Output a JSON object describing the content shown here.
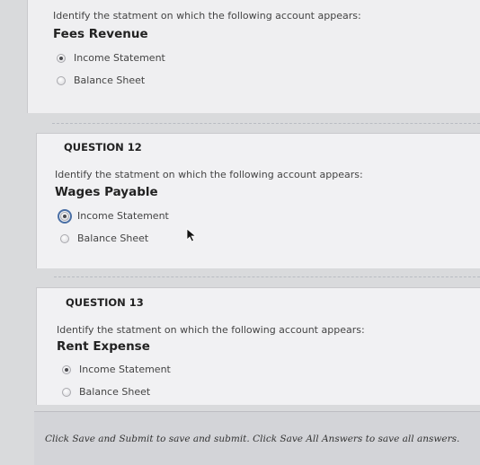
{
  "questions": [
    {
      "number_label": "",
      "prompt": "Identify the statment on which the following account appears:",
      "term": "Fees Revenue",
      "options": [
        {
          "label": "Income Statement",
          "selected": true
        },
        {
          "label": "Balance Sheet",
          "selected": false
        }
      ]
    },
    {
      "number_label": "QUESTION 12",
      "prompt": "Identify the statment on which the following account appears:",
      "term": "Wages Payable",
      "options": [
        {
          "label": "Income Statement",
          "selected": true
        },
        {
          "label": "Balance Sheet",
          "selected": false
        }
      ]
    },
    {
      "number_label": "QUESTION 13",
      "prompt": "Identify the statment on which the following account appears:",
      "term": "Rent Expense",
      "options": [
        {
          "label": "Income Statement",
          "selected": true
        },
        {
          "label": "Balance Sheet",
          "selected": false
        }
      ]
    }
  ],
  "footer": {
    "instructions": "Click Save and Submit to save and submit. Click Save All Answers to save all answers."
  },
  "icons": {
    "pointer": "mouse-cursor-icon"
  }
}
